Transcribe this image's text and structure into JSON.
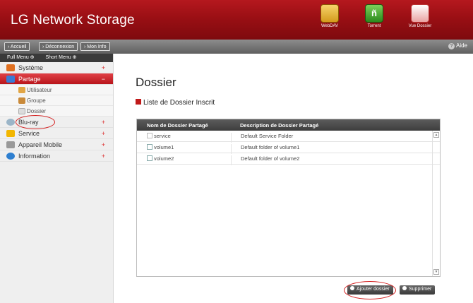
{
  "header": {
    "brand": "LG Network Storage",
    "icons": [
      {
        "label": "WebDAV",
        "icon": "webdav-icon"
      },
      {
        "label": "Torrent",
        "icon": "torrent-icon"
      },
      {
        "label": "Vue Dossier",
        "icon": "vue-dossier-icon"
      }
    ]
  },
  "toolbar": {
    "accueil": "› Accueil",
    "deconnexion": "› Déconnexion",
    "mon_info": "› Mon Info",
    "aide": "Aide"
  },
  "sidebar": {
    "full_menu": "Full Menu ⊕",
    "short_menu": "Short Menu ⊕",
    "items": [
      {
        "label": "Système",
        "icon": "system-icon",
        "color": "#e07020"
      },
      {
        "label": "Partage",
        "icon": "share-icon",
        "color": "#3a7bd5"
      },
      {
        "label": "Blu-ray",
        "icon": "bluray-icon",
        "color": "#8ab"
      },
      {
        "label": "Service",
        "icon": "service-icon",
        "color": "#f2b600"
      },
      {
        "label": "Appareil Mobile",
        "icon": "mobile-device-icon",
        "color": "#999"
      },
      {
        "label": "Information",
        "icon": "info-icon",
        "color": "#2e7fd0"
      }
    ],
    "subitems": [
      {
        "label": "Utilisateur",
        "icon": "user-icon"
      },
      {
        "label": "Groupe",
        "icon": "group-icon"
      },
      {
        "label": "Dossier",
        "icon": "folder-icon"
      }
    ],
    "plus": "+",
    "minus": "−"
  },
  "main": {
    "title": "Dossier",
    "section": "Liste de Dossier Inscrit",
    "table": {
      "col1": "Nom de Dossier Partagé",
      "col2": "Description de Dossier Partagé",
      "rows": [
        {
          "name": "service",
          "desc": "Default Service Folder"
        },
        {
          "name": "volume1",
          "desc": "Default folder of volume1"
        },
        {
          "name": "volume2",
          "desc": "Default folder of volume2"
        }
      ]
    },
    "buttons": {
      "add": "Ajouter dossier",
      "delete": "Supprimer"
    }
  },
  "colors": {
    "brand_red": "#a3121a",
    "accent_red": "#d42020"
  }
}
